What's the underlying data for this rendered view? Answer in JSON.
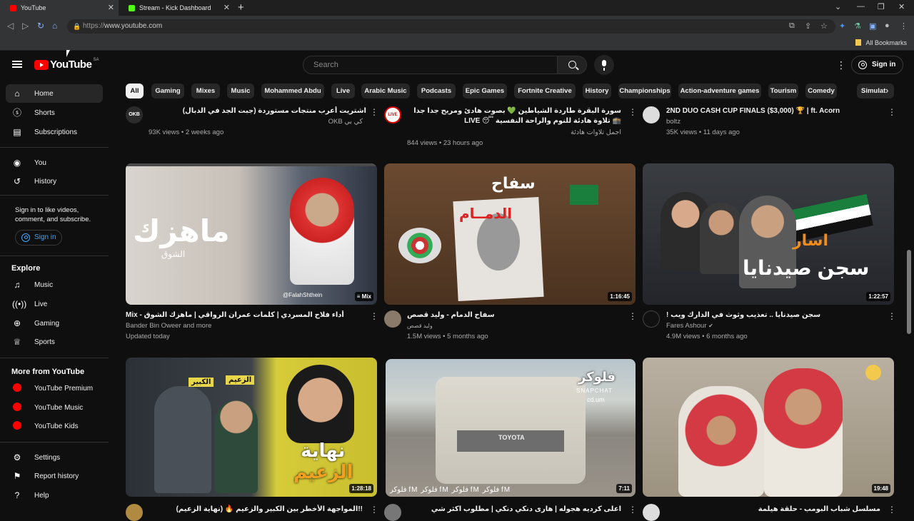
{
  "browser": {
    "tabs": [
      {
        "title": "YouTube",
        "favicon_color": "#ff0000"
      },
      {
        "title": "Stream - Kick Dashboard",
        "favicon_color": "#53fc18"
      }
    ],
    "new_tab_icon": "plus-icon",
    "url_prefix": "https://",
    "url_host": "www.youtube.com",
    "all_bookmarks": "All Bookmarks"
  },
  "header": {
    "logo_text": "YouTube",
    "country_code": "SA",
    "search_placeholder": "Search",
    "sign_in": "Sign in"
  },
  "sidebar": {
    "main": [
      {
        "label": "Home",
        "icon": "home-icon"
      },
      {
        "label": "Shorts",
        "icon": "shorts-icon"
      },
      {
        "label": "Subscriptions",
        "icon": "subscriptions-icon"
      }
    ],
    "you": [
      {
        "label": "You",
        "icon": "you-icon"
      },
      {
        "label": "History",
        "icon": "history-icon"
      }
    ],
    "signin_prompt": "Sign in to like videos, comment, and subscribe.",
    "signin_button": "Sign in",
    "explore_heading": "Explore",
    "explore": [
      {
        "label": "Music",
        "icon": "music-icon"
      },
      {
        "label": "Live",
        "icon": "live-icon"
      },
      {
        "label": "Gaming",
        "icon": "gaming-icon"
      },
      {
        "label": "Sports",
        "icon": "sports-icon"
      }
    ],
    "more_heading": "More from YouTube",
    "more": [
      {
        "label": "YouTube Premium"
      },
      {
        "label": "YouTube Music"
      },
      {
        "label": "YouTube Kids"
      }
    ],
    "bottom": [
      {
        "label": "Settings",
        "icon": "settings-icon"
      },
      {
        "label": "Report history",
        "icon": "flag-icon"
      },
      {
        "label": "Help",
        "icon": "help-icon"
      }
    ]
  },
  "chips": [
    "All",
    "Gaming",
    "Mixes",
    "Music",
    "Mohammed Abdu",
    "Live",
    "Arabic Music",
    "Podcasts",
    "Epic Games",
    "Fortnite Creative",
    "History",
    "Championships",
    "Action-adventure games",
    "Tourism",
    "Comedy",
    "Simulat"
  ],
  "top_row": [
    {
      "title": "اشتريت أعرب منتجات مستوردة (جبت الجد في الدبال)",
      "channel": "كي بي OKB",
      "meta": "93K views • 2 weeks ago",
      "avatar_text": "OKB"
    },
    {
      "title": "سورة البقرة طاردة الشياطين 💚 بصوت هادئ ومريح جدا جدا 🕋 تلاوة هادئة للنوم والراحة النفسية 😴 LIVE",
      "channel": "اجمل تلاوات هادئة",
      "meta": "844 views • 23 hours ago",
      "avatar_text": "LIVE"
    },
    {
      "title": "2ND DUO CASH CUP FINALS ($3,000) 🏆 | ft. Acorn",
      "channel": "boltz",
      "meta": "35K views • 11 days ago",
      "avatar_text": ""
    }
  ],
  "row2": [
    {
      "title": "Mix - أداء فلاح المسردي | كلمات عمران الرواقي | ماهزك الشوق",
      "channel": "Bander Bin Oweer and more",
      "meta": "Updated today",
      "duration": "Mix",
      "thumb_text": "ماهزك",
      "thumb_sub": "الشوق",
      "thumb_handle": "@FalahShthein"
    },
    {
      "title": "سفاح الدمام - وليد قصص",
      "channel": "وليد قصص",
      "meta": "1.5M views • 5 months ago",
      "duration": "1:16:45",
      "thumb_text": "الدمــام",
      "thumb_sub": "سفاح"
    },
    {
      "title": "سجن صيدنايا .. تعذيب وثوث في الدارك ويب !",
      "channel": "Fares Ashour",
      "meta": "4.9M views • 6 months ago",
      "duration": "1:22:57",
      "thumb_text": "سجن صيدنايا",
      "thumb_sub": "اسار"
    }
  ],
  "row3": [
    {
      "title": "!!المواجهة الأخطر بين الكبير والزعيم 🔥 (نهاية الزعيم)",
      "duration": "1:28:18",
      "thumb_text": "نهاية",
      "thumb_sub": "الزعيم",
      "tag1": "الكبير",
      "tag2": "الزعيم"
    },
    {
      "title": "اعلى كرديه هجوله | هارى دنكي دنكي | مطلوب اكثر شي",
      "duration": "7:11",
      "thumb_text": "فلوكر",
      "thumb_sub": "SNAPCHAT",
      "thumb_handle": "cd.um",
      "plate": "TOYOTA",
      "watermark": "فلوكر fM  فلوكر fM  فلوكر fM  فلوكر fM"
    },
    {
      "title": "مسلسل شباب البومب - حلقة هيلمة",
      "duration": "19:48"
    }
  ]
}
